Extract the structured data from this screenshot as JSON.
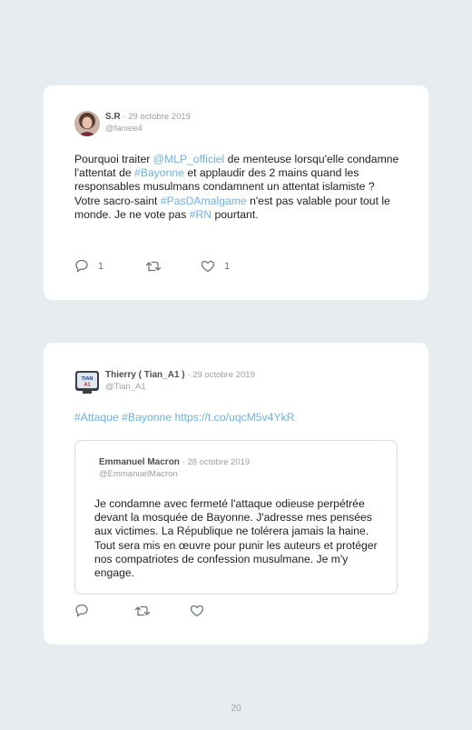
{
  "tweets": [
    {
      "author": "S.R",
      "date": "· 29 octobre 2019",
      "handle": "@faniee4",
      "text_parts": [
        {
          "t": "Pourquoi traiter "
        },
        {
          "t": "@MLP_officiel",
          "link": true
        },
        {
          "t": " de menteuse lorsqu'elle condamne l'attentat de "
        },
        {
          "t": "#Bayonne",
          "link": true
        },
        {
          "t": " et applaudir des 2 mains quand les responsables musulmans condamnent un attentat islamiste ? Votre sacro-saint "
        },
        {
          "t": "#PasDAmalgame",
          "link": true
        },
        {
          "t": " n'est pas valable pour tout le monde. Je ne vote pas "
        },
        {
          "t": "#RN",
          "link": true
        },
        {
          "t": " pourtant."
        }
      ],
      "reply_count": "1",
      "like_count": "1"
    },
    {
      "author": "Thierry ( Tian_A1 )",
      "date": "· 29 octobre 2019",
      "handle": "@Tian_A1",
      "avatar_text": "TIAN A1",
      "text": "#Attaque #Bayonne https://t.co/uqcM5v4YkR",
      "quoted": {
        "author": "Emmanuel Macron",
        "date": "· 28 octobre 2019",
        "handle": "@EmmanuelMacron",
        "text": "Je condamne avec fermeté l'attaque odieuse perpétrée devant la mosquée de Bayonne. J'adresse mes pensées aux victimes. La République ne tolérera jamais la haine. Tout sera mis en œuvre pour punir les auteurs et protéger nos compatriotes de confession musulmane. Je m'y engage."
      }
    }
  ],
  "page_number": "20",
  "colors": {
    "link": "#6cb2e8",
    "background": "#e6ecef",
    "card": "#ffffff"
  },
  "icons": [
    "reply-icon",
    "retweet-icon",
    "like-icon"
  ]
}
